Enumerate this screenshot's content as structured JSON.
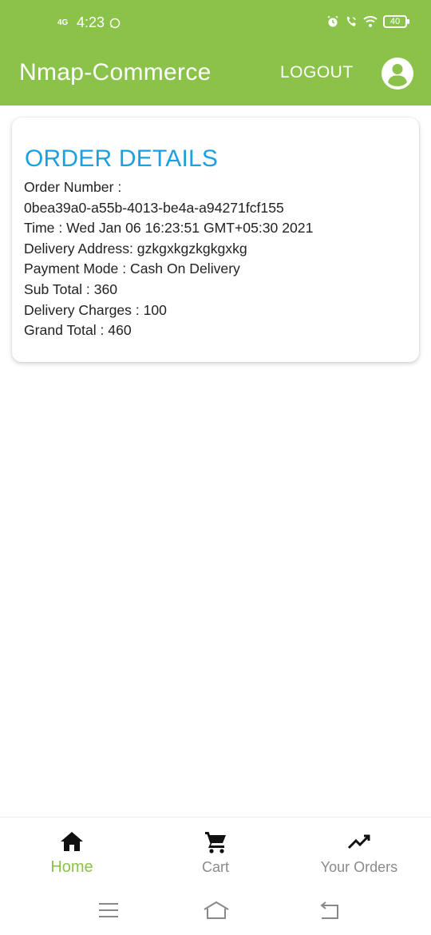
{
  "status_bar": {
    "network": "4G",
    "time": "4:23",
    "battery": "40",
    "icons": [
      "whatsapp-icon",
      "alarm-icon",
      "wifi-call-icon",
      "wifi-icon",
      "battery-icon"
    ]
  },
  "app_bar": {
    "title": "Nmap-Commerce",
    "logout_label": "LOGOUT",
    "account_icon": "account-circle-icon"
  },
  "order": {
    "heading": "ORDER DETAILS",
    "lines": [
      "Order Number :",
      "0bea39a0-a55b-4013-be4a-a94271fcf155",
      "Time : Wed Jan 06 16:23:51 GMT+05:30 2021",
      "Delivery Address:  gzkgxkgzkgkgxkg",
      "Payment Mode : Cash On Delivery",
      "Sub Total : 360",
      "Delivery Charges : 100",
      "Grand Total : 460"
    ]
  },
  "bottom_nav": {
    "tabs": [
      {
        "label": "Home",
        "icon": "home-icon",
        "active": true
      },
      {
        "label": "Cart",
        "icon": "cart-icon",
        "active": false
      },
      {
        "label": "Your Orders",
        "icon": "trending-up-icon",
        "active": false
      }
    ]
  },
  "system_nav": {
    "icons": [
      "menu-icon",
      "home-outline-icon",
      "back-icon"
    ]
  },
  "colors": {
    "primary": "#8bc34a",
    "heading": "#1ba1e2",
    "inactive_tab": "#8a8a8a"
  }
}
